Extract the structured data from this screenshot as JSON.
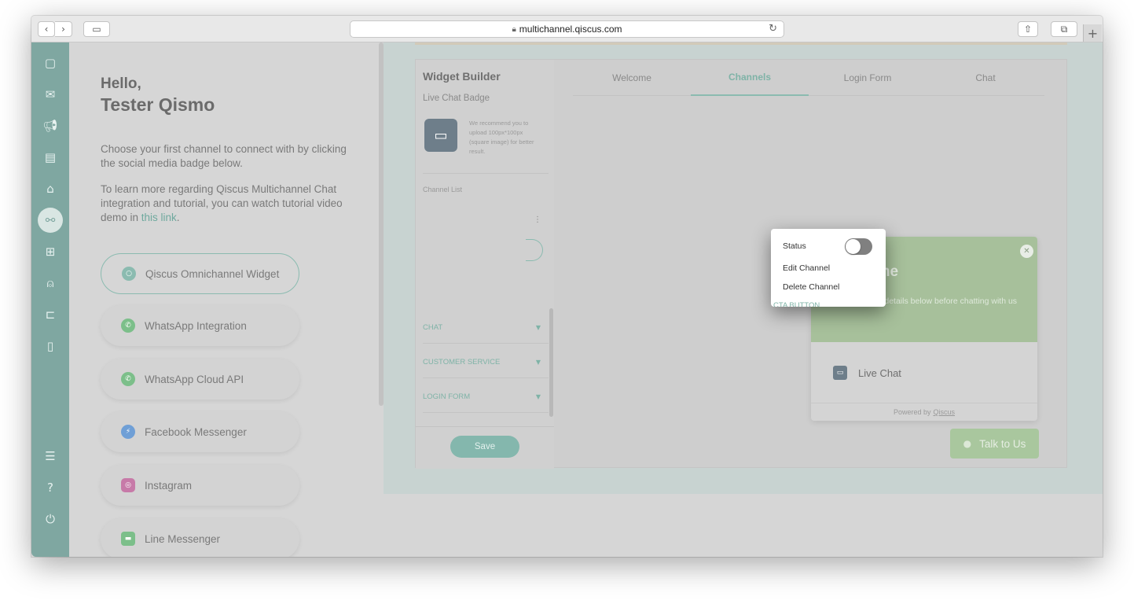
{
  "browser": {
    "url": "multichannel.qiscus.com",
    "lock_icon": "lock-icon",
    "new_tab_label": "+"
  },
  "sidebar": {
    "items": [
      "chat-icon",
      "mail-icon",
      "megaphone-icon",
      "contact-card-icon",
      "analytics-icon",
      "integration-icon",
      "apps-icon",
      "agent-icon",
      "ticket-icon",
      "mobile-icon",
      "settings-sliders-icon",
      "help-icon",
      "power-icon"
    ],
    "active": "integration-icon"
  },
  "intro": {
    "greeting": "Hello,",
    "username": "Tester Qismo",
    "choose_text": "Choose your first channel to connect with by clicking the social media badge below.",
    "tutorial_text": "To learn more regarding Qiscus Multichannel Chat integration and tutorial, you can watch tutorial video demo in ",
    "tutorial_link": "this link",
    "tutorial_end": "."
  },
  "channels": [
    {
      "label": "Qiscus Omnichannel Widget",
      "icon": "qiscus-icon",
      "color": "#8bbbb0"
    },
    {
      "label": "WhatsApp Integration",
      "icon": "whatsapp-icon",
      "color": "#7cbf8a"
    },
    {
      "label": "WhatsApp Cloud API",
      "icon": "whatsapp-icon",
      "color": "#7cbf8a"
    },
    {
      "label": "Facebook Messenger",
      "icon": "messenger-icon",
      "color": "#6f9fd6"
    },
    {
      "label": "Instagram",
      "icon": "instagram-icon",
      "color": "#c77aa8"
    },
    {
      "label": "Line Messenger",
      "icon": "line-icon",
      "color": "#7cbf8a"
    }
  ],
  "builder": {
    "title": "Widget Builder",
    "badge_label": "Live Chat Badge",
    "recommend": "We recommend you to upload 100px*100px (square image) for better result.",
    "channel_list_label": "Channel List",
    "sections": [
      "CTA BUTTON",
      "CHAT",
      "CUSTOMER SERVICE",
      "LOGIN FORM"
    ],
    "save_label": "Save"
  },
  "tabs": [
    "Welcome",
    "Channels",
    "Login Form",
    "Chat"
  ],
  "active_tab": "Channels",
  "preview": {
    "welcome": "Welcome",
    "desc": "Please fill the details below before chatting with us",
    "item": "Live Chat",
    "powered_by": "Powered by",
    "brand": "Qiscus",
    "talk_button": "Talk to Us"
  },
  "popup": {
    "status_label": "Status",
    "status_on": false,
    "edit_label": "Edit Channel",
    "delete_label": "Delete Channel",
    "cta_label": "CTA BUTTON"
  },
  "colors": {
    "sidebar": "#7fa7a1",
    "accent": "#8bbbb0",
    "preview_header": "#a7c09b"
  }
}
